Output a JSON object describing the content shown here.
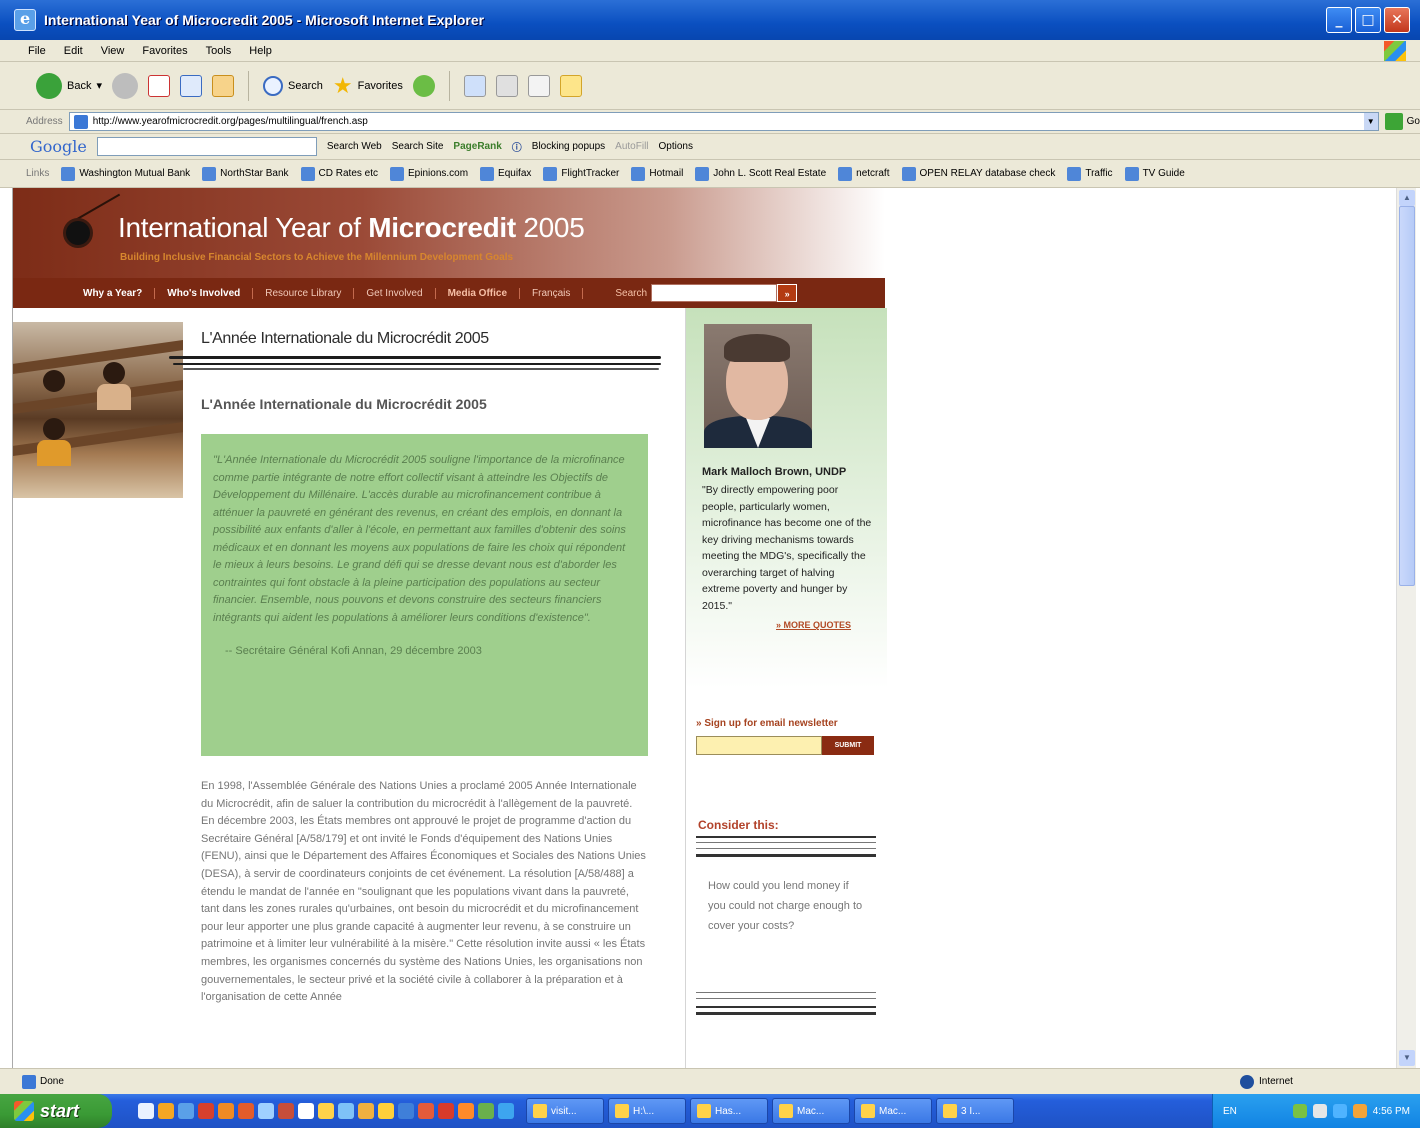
{
  "window": {
    "title": "International Year of Microcredit 2005 - Microsoft Internet Explorer",
    "minimize": "_",
    "maximize": "□",
    "close": "✕"
  },
  "menu": [
    "File",
    "Edit",
    "View",
    "Favorites",
    "Tools",
    "Help"
  ],
  "toolbar": {
    "back": "Back",
    "search": "Search",
    "favorites": "Favorites"
  },
  "address": {
    "label": "Address",
    "url": "http://www.yearofmicrocredit.org/pages/multilingual/french.asp",
    "go": "Go"
  },
  "googlebar": {
    "logo": "Google",
    "search_web": "Search Web",
    "search_site": "Search Site",
    "pagerank": "PageRank",
    "blocking": "Blocking popups",
    "autofill": "AutoFill",
    "options": "Options"
  },
  "links": {
    "label": "Links",
    "items": [
      "Washington Mutual Bank",
      "NorthStar Bank",
      "CD Rates etc",
      "Epinions.com",
      "Equifax",
      "FlightTracker",
      "Hotmail",
      "John L. Scott Real Estate",
      "netcraft",
      "OPEN RELAY database check",
      "Traffic",
      "TV Guide"
    ]
  },
  "site": {
    "title_pre": "International Year of ",
    "title_bold": "Microcredit",
    "title_post": " 2005",
    "subtitle": "Building Inclusive Financial Sectors to Achieve the Millennium Development Goals",
    "nav": [
      "Why a Year?",
      "Who's Involved",
      "Resource Library",
      "Get Involved",
      "Media Office",
      "Français"
    ],
    "search_label": "Search",
    "search_button": "»"
  },
  "main": {
    "heading": "L'Année Internationale du Microcrédit 2005",
    "subheading": "L'Année Internationale du Microcrédit 2005",
    "quote": "\"L'Année Internationale du Microcrédit 2005 souligne l'importance de la microfinance comme partie intégrante de notre effort collectif visant à atteindre les Objectifs de Développement du Millénaire. L'accès durable au microfinancement contribue à atténuer la pauvreté en générant des revenus, en créant des emplois, en donnant la possibilité aux enfants d'aller à l'école, en permettant aux familles d'obtenir des soins médicaux et en donnant les moyens aux populations de faire les choix qui répondent le mieux à leurs besoins. Le grand défi qui se dresse devant nous est d'aborder les contraintes qui font obstacle à la pleine participation des populations au secteur financier. Ensemble, nous pouvons et devons construire des secteurs financiers intégrants qui aident les populations à améliorer leurs conditions d'existence\".",
    "quote_author": "-- Secrétaire Général Kofi Annan, 29 décembre 2003",
    "body": "En 1998, l'Assemblée Générale des Nations Unies a proclamé 2005 Année Internationale du Microcrédit, afin de saluer la contribution du microcrédit à l'allègement de la pauvreté. En décembre 2003, les États membres ont approuvé le projet de programme d'action du Secrétaire Général [A/58/179] et ont invité le Fonds d'équipement des Nations Unies (FENU), ainsi que le Département des Affaires Économiques et Sociales des Nations Unies (DESA), à servir de coordinateurs conjoints de cet événement. La résolution [A/58/488] a étendu le mandat de l'année en \"soulignant que les populations vivant dans la pauvreté, tant dans les zones rurales qu'urbaines, ont besoin du microcrédit et du microfinancement pour leur apporter une plus grande capacité à augmenter leur revenu, à se construire un patrimoine et à limiter leur vulnérabilité à la misère.\" Cette résolution invite aussi « les États membres, les organismes concernés du système des Nations Unies, les organisations non gouvernementales, le secteur privé et la société civile à collaborer à la préparation et à l'organisation de cette Année"
  },
  "sidebar": {
    "name": "Mark Malloch Brown, UNDP",
    "quote": "\"By directly empowering poor people, particularly women, microfinance has become one of the key driving mechanisms towards meeting the MDG's, specifically the overarching target of halving extreme poverty and hunger by 2015.\"",
    "more": "» MORE QUOTES",
    "signup": "» Sign up for email newsletter",
    "submit": "SUBMIT",
    "consider": "Consider this:",
    "question": "How could you lend money if you could not charge enough to cover your costs?"
  },
  "status": {
    "left": "Done",
    "zone": "Internet"
  },
  "taskbar": {
    "start": "start",
    "tasks": [
      "visit...",
      "H:\\...",
      "Has...",
      "Mac...",
      "Mac...",
      "3 I..."
    ],
    "lang": "EN",
    "clock": "4:56 PM"
  }
}
